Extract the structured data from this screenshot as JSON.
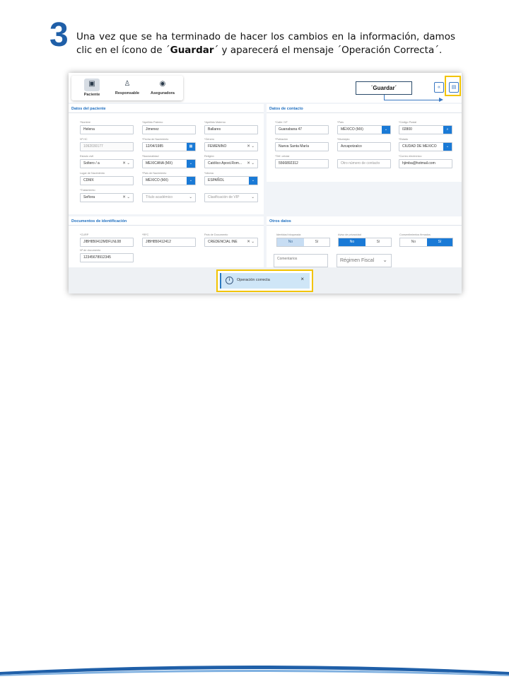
{
  "slide": {
    "step_number": "3",
    "instruction_part1": "Una vez que se ha terminado de hacer los cambios en la información, damos clic en el ícono de ´",
    "instruction_bold": "Guardar",
    "instruction_part2": "´ y  aparecerá el mensaje ´Operación  Correcta´."
  },
  "app": {
    "nav": [
      {
        "label": "Paciente",
        "icon": "id-card-icon",
        "glyph": "▣"
      },
      {
        "label": "Responsable",
        "icon": "person-add-icon",
        "glyph": "♙"
      },
      {
        "label": "Aseguradora",
        "icon": "money-card-icon",
        "glyph": "◉"
      }
    ],
    "callout_label": "´Guardar´",
    "back_glyph": "«",
    "save_glyph": "▤",
    "accent_color": "#1a7ad6",
    "highlight_color": "#f2c400",
    "patient": {
      "title": "Datos del paciente",
      "fields": [
        {
          "label": "*Nombre",
          "value": "Helena"
        },
        {
          "label": "*Apellido Paterno",
          "value": "Jimenez"
        },
        {
          "label": "*Apellido Materno",
          "value": "Ballares"
        },
        {
          "label": "Nº HC",
          "value": "1092030177"
        },
        {
          "label": "*Fecha de Nacimiento",
          "value": "12/04/1985"
        },
        {
          "label": "*Género",
          "value": "FEMENINO"
        },
        {
          "label": "Estado civil",
          "value": "Soltero / a"
        },
        {
          "label": "*Nacionalidad",
          "value": "MEXICANA (MX)"
        },
        {
          "label": "Religión",
          "value": "Católico Apost.Rom..."
        },
        {
          "label": "Lugar de Nacimiento",
          "value": "CDMX"
        },
        {
          "label": "*País de Nacimiento",
          "value": "MÉXICO (MX)"
        },
        {
          "label": "*Idioma",
          "value": "ESPAÑOL"
        },
        {
          "label": "*Tratamiento",
          "value": "Señora"
        },
        {
          "label": "",
          "value": "Título académico"
        },
        {
          "label": "",
          "value": "Clasificación de VIP"
        }
      ]
    },
    "contact": {
      "title": "Datos de contacto",
      "fields": [
        {
          "label": "*Calle / Nº",
          "value": "Guanabana 47"
        },
        {
          "label": "*País",
          "value": "MÉXICO (MX)"
        },
        {
          "label": "*Código Postal",
          "value": "02800"
        },
        {
          "label": "*Población",
          "value": "Nueva Santa María"
        },
        {
          "label": "*Municipio",
          "value": "Azcapotzalco"
        },
        {
          "label": "*Estado",
          "value": "CIUDAD DE MEXICO"
        },
        {
          "label": "*Telf. celular",
          "value": "5566892312"
        },
        {
          "label": "",
          "value": "Otro número de contacto"
        },
        {
          "label": "*Correo electrónico",
          "value": "hjimba@hotmail.com"
        }
      ]
    },
    "documents": {
      "title": "Documentos de identificación",
      "fields": [
        {
          "label": "*CURP",
          "value": "JIBH850412MDFLNL08"
        },
        {
          "label": "*RFC",
          "value": "JIBH850412412"
        },
        {
          "label": "País de Documento",
          "value": "CREDENCIAL INE"
        },
        {
          "label": "Nº de documento",
          "value": "12345678912345"
        }
      ]
    },
    "other": {
      "title": "Otros datos",
      "toggles": [
        {
          "label": "Identidad bloqueada",
          "no": "No",
          "yes": "Sí",
          "selected": "No"
        },
        {
          "label": "Aviso de privacidad",
          "no": "No",
          "yes": "Sí",
          "selected": "No"
        },
        {
          "label": "Consentimientos firmados",
          "no": "No",
          "yes": "Sí",
          "selected": "Sí"
        }
      ],
      "comments_placeholder": "Comentarios",
      "regimen_placeholder": "Régimen Fiscal"
    },
    "toast": {
      "message": "Operación correcta",
      "info_glyph": "i",
      "close_glyph": "×"
    }
  }
}
